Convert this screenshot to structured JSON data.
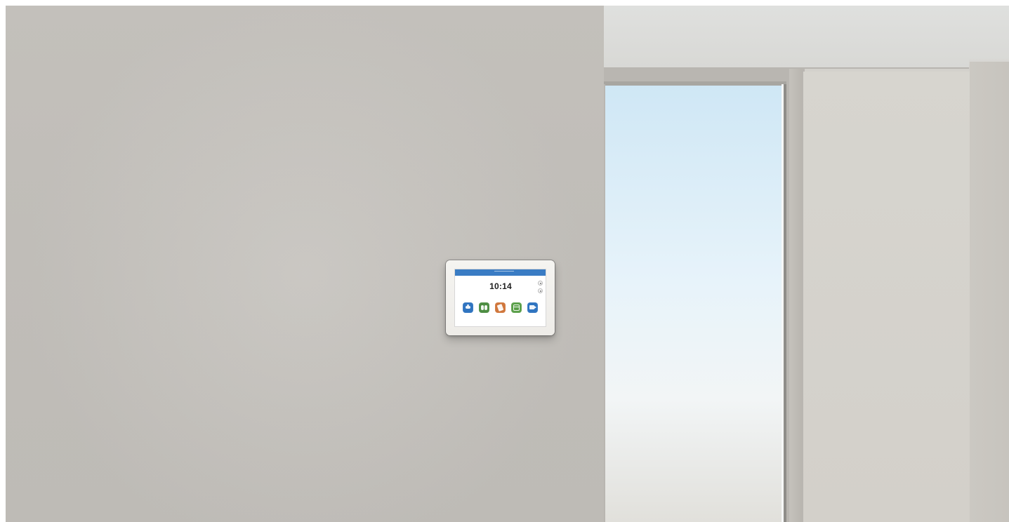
{
  "scene": {
    "colors": {
      "left_wall": "#c7c4bf",
      "ceiling": "#dcdcda",
      "window_sky": "#dbeef8",
      "right_wall": "#d3d0ca"
    }
  },
  "device": {
    "time": "10:14",
    "date": "",
    "day": "",
    "colors": {
      "top_bar": "#3a7cc4",
      "frame": "#f1efeb"
    },
    "apps": [
      {
        "icon": "video-call-icon",
        "label": "",
        "color": "#2f74c0"
      },
      {
        "icon": "people-icon",
        "label": "",
        "color": "#4d8d42"
      },
      {
        "icon": "share-icon",
        "label": "",
        "color": "#d0763b"
      },
      {
        "icon": "calendar-icon",
        "label": "",
        "color": "#5a9f49"
      },
      {
        "icon": "camera-icon",
        "label": "",
        "color": "#2f74c0"
      }
    ]
  }
}
